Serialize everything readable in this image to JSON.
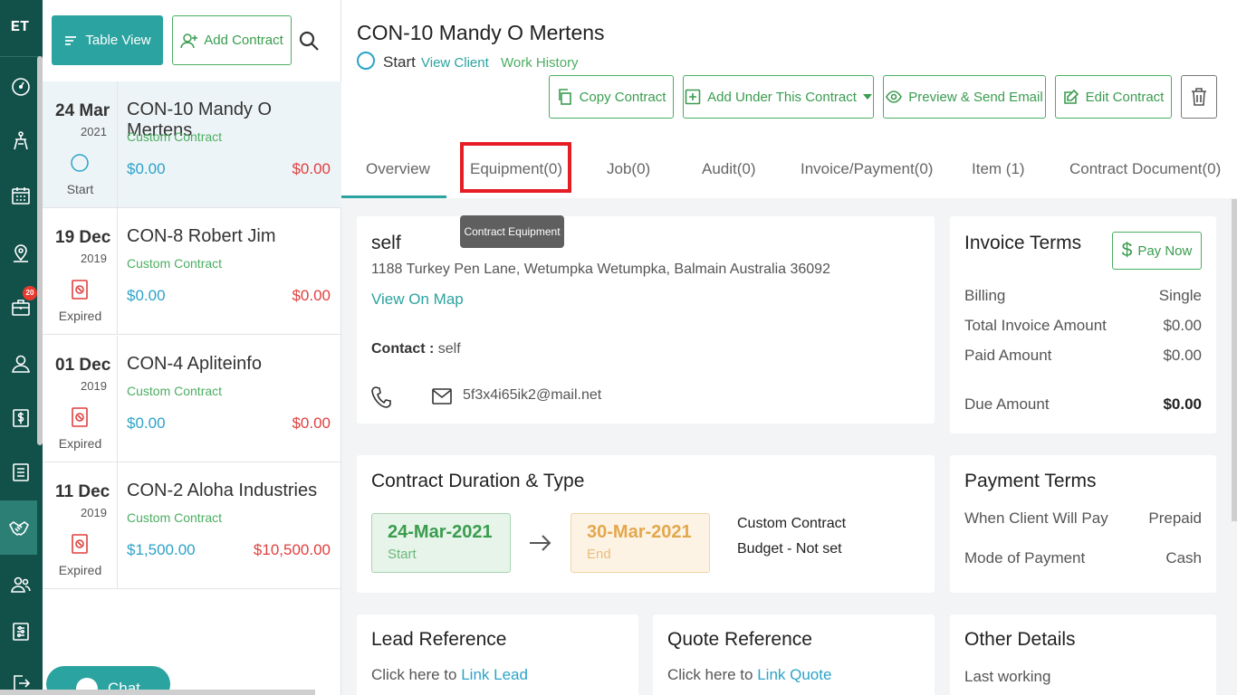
{
  "app": {
    "logo_text": "ET",
    "notification_badge": "20"
  },
  "rail_icons": [
    "dashboard-icon",
    "funnel-icon",
    "calendar-icon",
    "map-pin-icon",
    "briefcase-icon",
    "user-icon",
    "dollar-icon",
    "list-icon",
    "handshake-icon",
    "users-icon",
    "sliders-icon",
    "logout-icon"
  ],
  "list_panel": {
    "table_view_label": "Table View",
    "add_contract_label": "Add Contract",
    "contracts": [
      {
        "day": "24 Mar",
        "year": "2021",
        "status": "Start",
        "title": "CON-10 Mandy O Mertens",
        "type": "Custom Contract",
        "amount_paid": "$0.00",
        "amount_due": "$0.00"
      },
      {
        "day": "19 Dec",
        "year": "2019",
        "status": "Expired",
        "title": "CON-8 Robert Jim",
        "type": "Custom Contract",
        "amount_paid": "$0.00",
        "amount_due": "$0.00"
      },
      {
        "day": "01 Dec",
        "year": "2019",
        "status": "Expired",
        "title": "CON-4 Apliteinfo",
        "type": "Custom Contract",
        "amount_paid": "$0.00",
        "amount_due": "$0.00"
      },
      {
        "day": "11 Dec",
        "year": "2019",
        "status": "Expired",
        "title": "CON-2 Aloha Industries",
        "type": "Custom Contract",
        "amount_paid": "$1,500.00",
        "amount_due": "$10,500.00"
      }
    ],
    "chat_label": "Chat"
  },
  "header": {
    "title": "CON-10 Mandy O Mertens",
    "status": "Start",
    "view_client": "View Client",
    "work_history": "Work History",
    "copy_contract": "Copy Contract",
    "add_under": "Add Under This Contract",
    "preview_send": "Preview & Send Email",
    "edit_contract": "Edit Contract"
  },
  "tabs": [
    "Overview",
    "Equipment(0)",
    "Job(0)",
    "Audit(0)",
    "Invoice/Payment(0)",
    "Item (1)",
    "Contract Document(0)"
  ],
  "tooltip": "Contract Equipment",
  "client_card": {
    "name": "self",
    "address": "1188 Turkey Pen Lane, Wetumpka Wetumpka, Balmain Australia 36092",
    "view_on_map": "View On Map",
    "contact_label": "Contact :",
    "contact_value": "self",
    "email": "5f3x4i65ik2@mail.net"
  },
  "invoice_terms": {
    "title": "Invoice Terms",
    "pay_now": "Pay Now",
    "rows": [
      {
        "label": "Billing",
        "value": "Single"
      },
      {
        "label": "Total Invoice Amount",
        "value": "$0.00"
      },
      {
        "label": "Paid Amount",
        "value": "$0.00"
      },
      {
        "label": "Due Amount",
        "value": "$0.00"
      }
    ]
  },
  "duration": {
    "title": "Contract Duration & Type",
    "start_date": "24-Mar-2021",
    "start_label": "Start",
    "end_date": "30-Mar-2021",
    "end_label": "End",
    "type": "Custom Contract",
    "budget": "Budget - Not set"
  },
  "payment_terms": {
    "title": "Payment Terms",
    "rows": [
      {
        "label": "When Client Will Pay",
        "value": "Prepaid"
      },
      {
        "label": "Mode of Payment",
        "value": "Cash"
      }
    ]
  },
  "lead_reference": {
    "title": "Lead Reference",
    "prefix": "Click here to",
    "link": "Link Lead"
  },
  "quote_reference": {
    "title": "Quote Reference",
    "prefix": "Click here to",
    "link": "Link Quote"
  },
  "other_details": {
    "title": "Other Details",
    "row1": "Last working"
  },
  "colors": {
    "brand_dark": "#12504a",
    "accent_teal": "#2ba3a0",
    "accent_green": "#4bae61",
    "link_blue": "#2ba3c8",
    "danger_red": "#e03f3f"
  }
}
